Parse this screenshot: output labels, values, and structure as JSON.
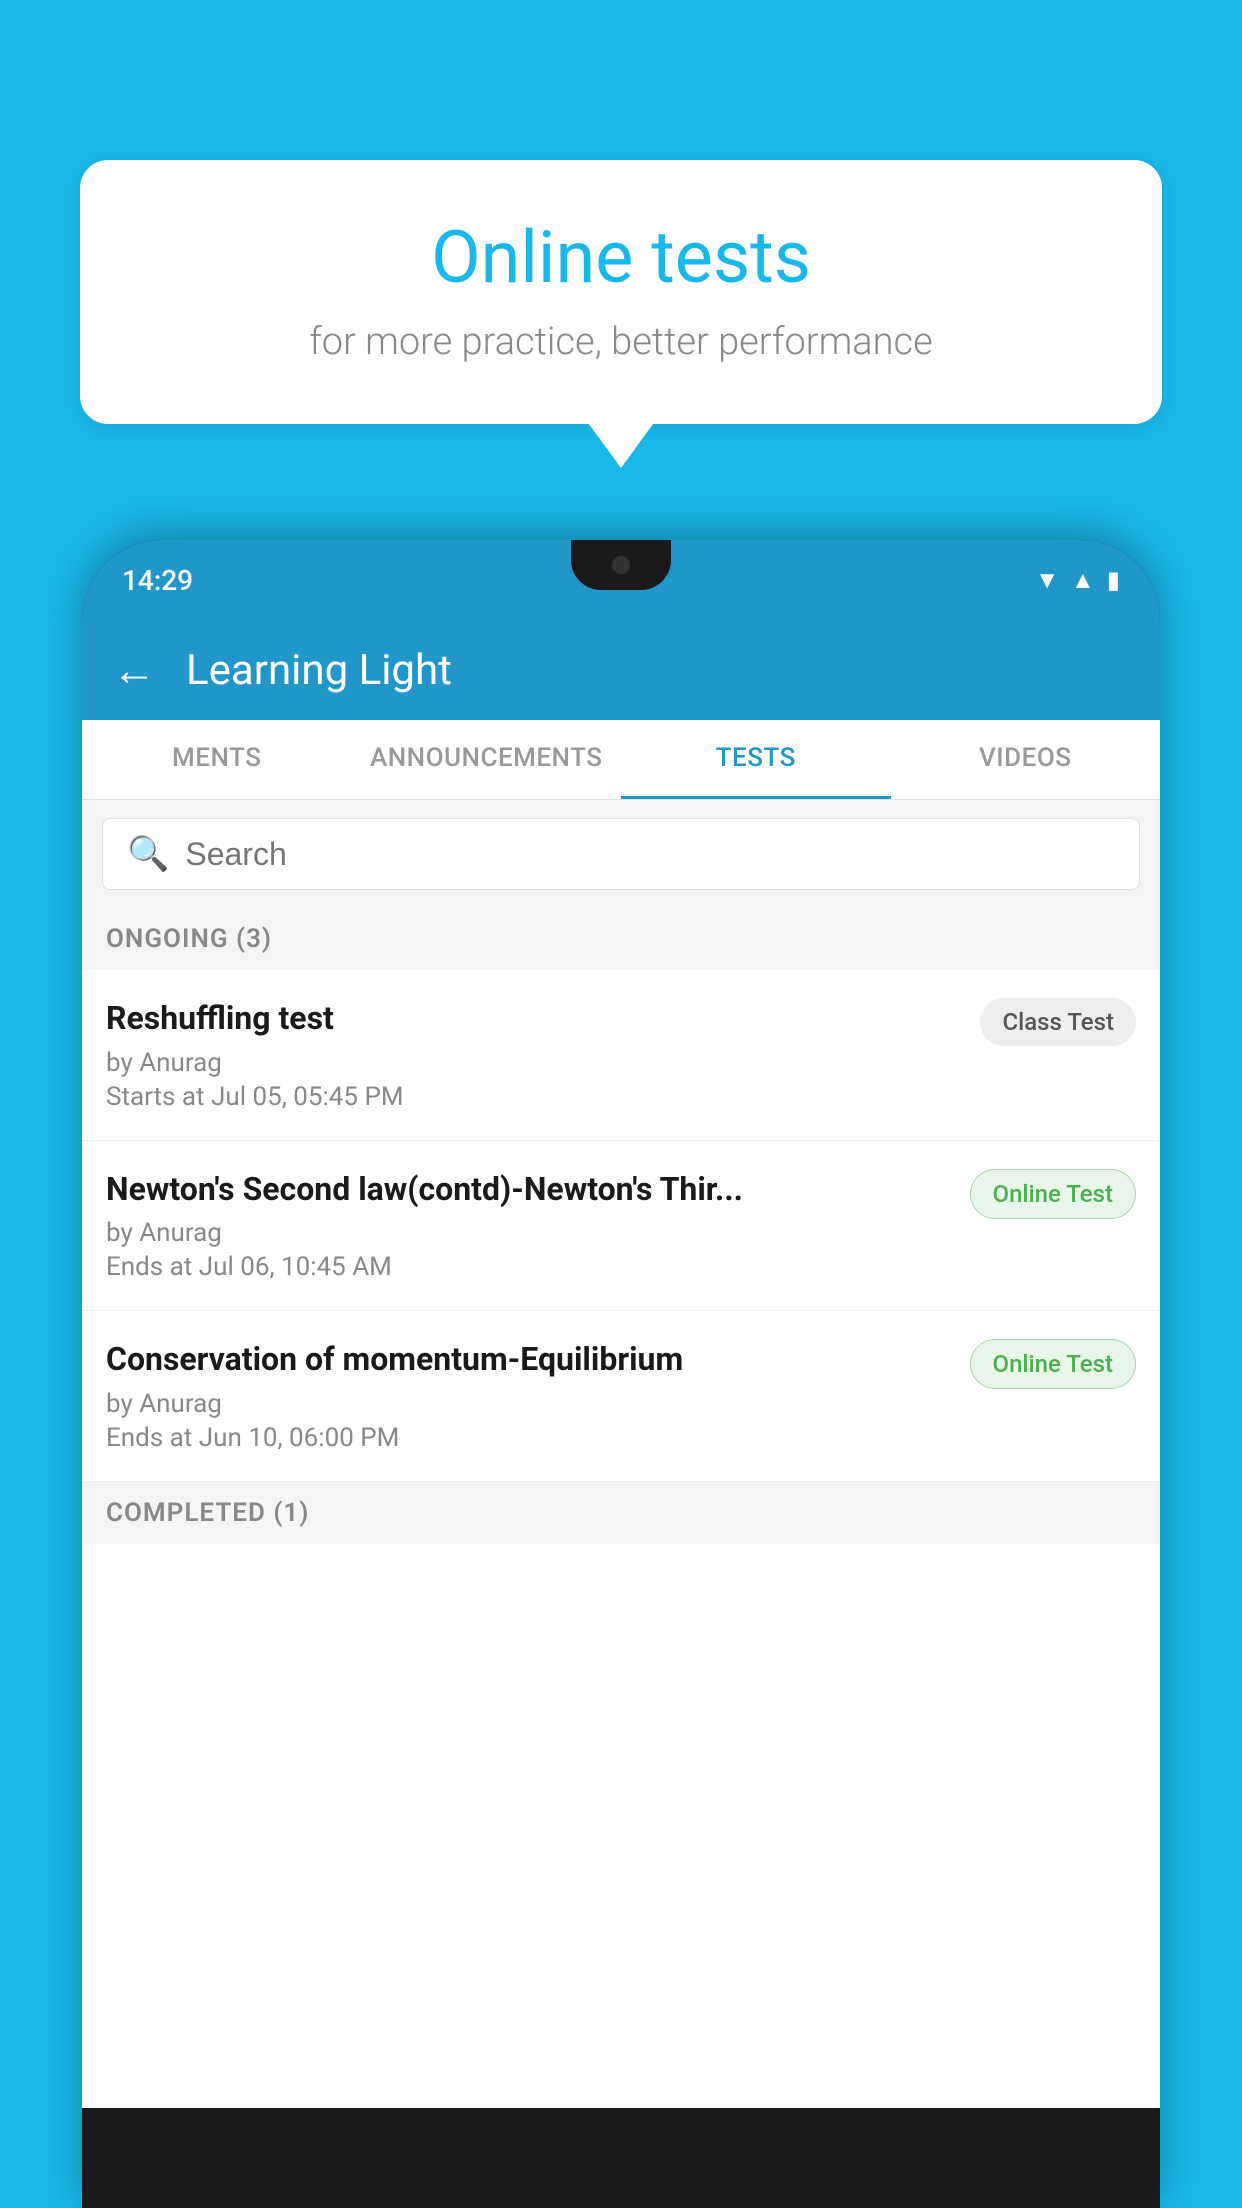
{
  "background_color": "#1ab8e8",
  "speech_bubble": {
    "title": "Online tests",
    "subtitle": "for more practice, better performance"
  },
  "phone": {
    "status_bar": {
      "time": "14:29",
      "icons": [
        "wifi",
        "signal",
        "battery"
      ]
    },
    "header": {
      "title": "Learning Light",
      "back_label": "←"
    },
    "tabs": [
      {
        "label": "MENTS",
        "active": false
      },
      {
        "label": "ANNOUNCEMENTS",
        "active": false
      },
      {
        "label": "TESTS",
        "active": true
      },
      {
        "label": "VIDEOS",
        "active": false
      }
    ],
    "search": {
      "placeholder": "Search"
    },
    "ongoing_section": {
      "label": "ONGOING (3)"
    },
    "tests": [
      {
        "name": "Reshuffling test",
        "author": "by Anurag",
        "date_label": "Starts at",
        "date": "Jul 05, 05:45 PM",
        "badge": "Class Test",
        "badge_type": "class"
      },
      {
        "name": "Newton's Second law(contd)-Newton's Thir...",
        "author": "by Anurag",
        "date_label": "Ends at",
        "date": "Jul 06, 10:45 AM",
        "badge": "Online Test",
        "badge_type": "online"
      },
      {
        "name": "Conservation of momentum-Equilibrium",
        "author": "by Anurag",
        "date_label": "Ends at",
        "date": "Jun 10, 06:00 PM",
        "badge": "Online Test",
        "badge_type": "online"
      }
    ],
    "completed_section": {
      "label": "COMPLETED (1)"
    }
  }
}
